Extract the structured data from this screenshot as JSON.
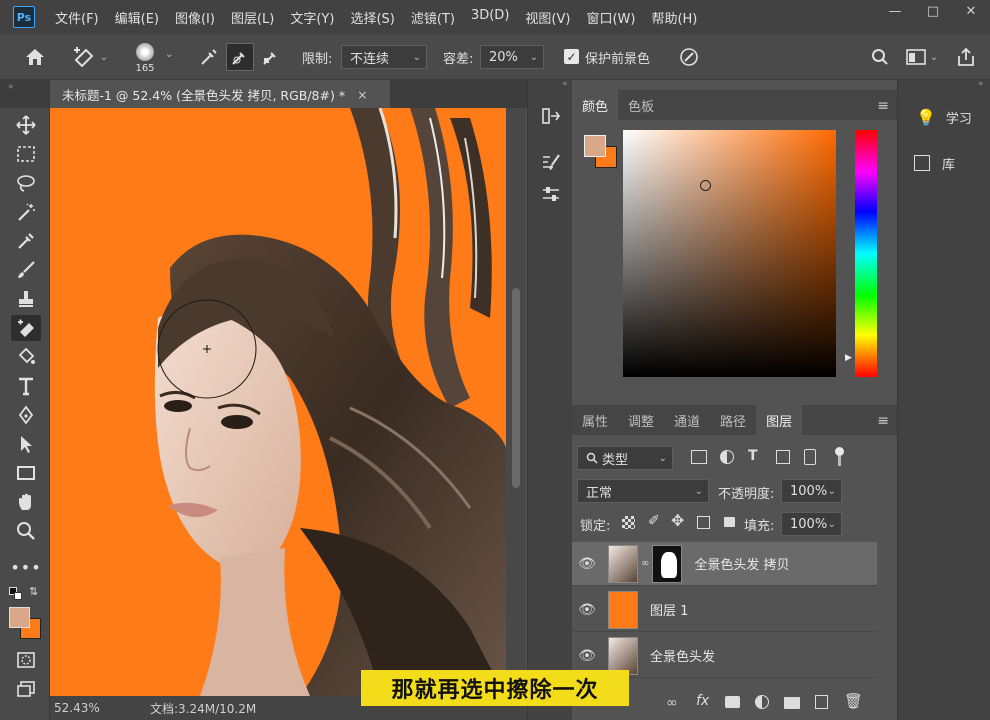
{
  "app": {
    "logo": "Ps"
  },
  "menu": [
    "文件(F)",
    "编辑(E)",
    "图像(I)",
    "图层(L)",
    "文字(Y)",
    "选择(S)",
    "滤镜(T)",
    "3D(D)",
    "视图(V)",
    "窗口(W)",
    "帮助(H)"
  ],
  "options": {
    "brush_size": "165",
    "limit_label": "限制:",
    "limit_value": "不连续",
    "tolerance_label": "容差:",
    "tolerance_value": "20%",
    "protect_label": "保护前景色"
  },
  "document": {
    "tab_title": "未标题-1 @ 52.4% (全景色头发 拷贝, RGB/8#) *",
    "zoom": "52.43%",
    "doc_size": "文档:3.24M/10.2M"
  },
  "colors": {
    "foreground": "#d9a888",
    "background": "#ff7b17",
    "canvas_bg": "#ff7b17",
    "subtitle_bg": "#f3dd1b"
  },
  "color_panel": {
    "tabs": [
      "颜色",
      "色板"
    ]
  },
  "layers_panel": {
    "tabs": [
      "属性",
      "调整",
      "通道",
      "路径",
      "图层"
    ],
    "filter_label": "类型",
    "blend_mode": "正常",
    "opacity_label": "不透明度:",
    "opacity_value": "100%",
    "lock_label": "锁定:",
    "fill_label": "填充:",
    "fill_value": "100%",
    "layers": [
      {
        "name": "全景色头发 拷贝",
        "selected": true
      },
      {
        "name": "图层 1",
        "selected": false
      },
      {
        "name": "全景色头发",
        "selected": false
      }
    ]
  },
  "right_panel": {
    "items": [
      "学习",
      "库"
    ]
  },
  "subtitle": "那就再选中擦除一次"
}
